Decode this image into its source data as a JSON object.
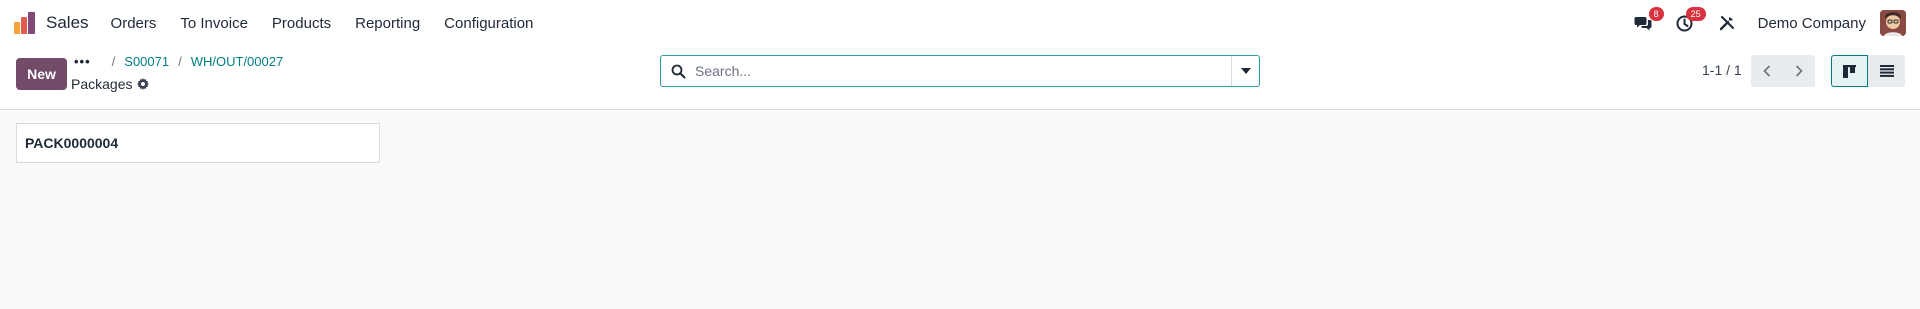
{
  "navbar": {
    "app_name": "Sales",
    "menu": [
      "Orders",
      "To Invoice",
      "Products",
      "Reporting",
      "Configuration"
    ],
    "messages_count": "8",
    "activities_count": "25",
    "company": "Demo Company",
    "icons": [
      "chat-icon",
      "clock-icon",
      "tools-icon"
    ]
  },
  "control_panel": {
    "new_label": "New",
    "breadcrumb": {
      "dots": "•••",
      "separator": "/",
      "items": [
        "S00071",
        "WH/OUT/00027"
      ]
    },
    "title": "Packages",
    "search": {
      "placeholder": "Search..."
    },
    "pager": {
      "value": "1-1 / 1"
    }
  },
  "records": [
    {
      "name": "PACK0000004"
    }
  ],
  "colors": {
    "brand": "#714b67",
    "link": "#017e84",
    "badge": "#d9323e"
  }
}
